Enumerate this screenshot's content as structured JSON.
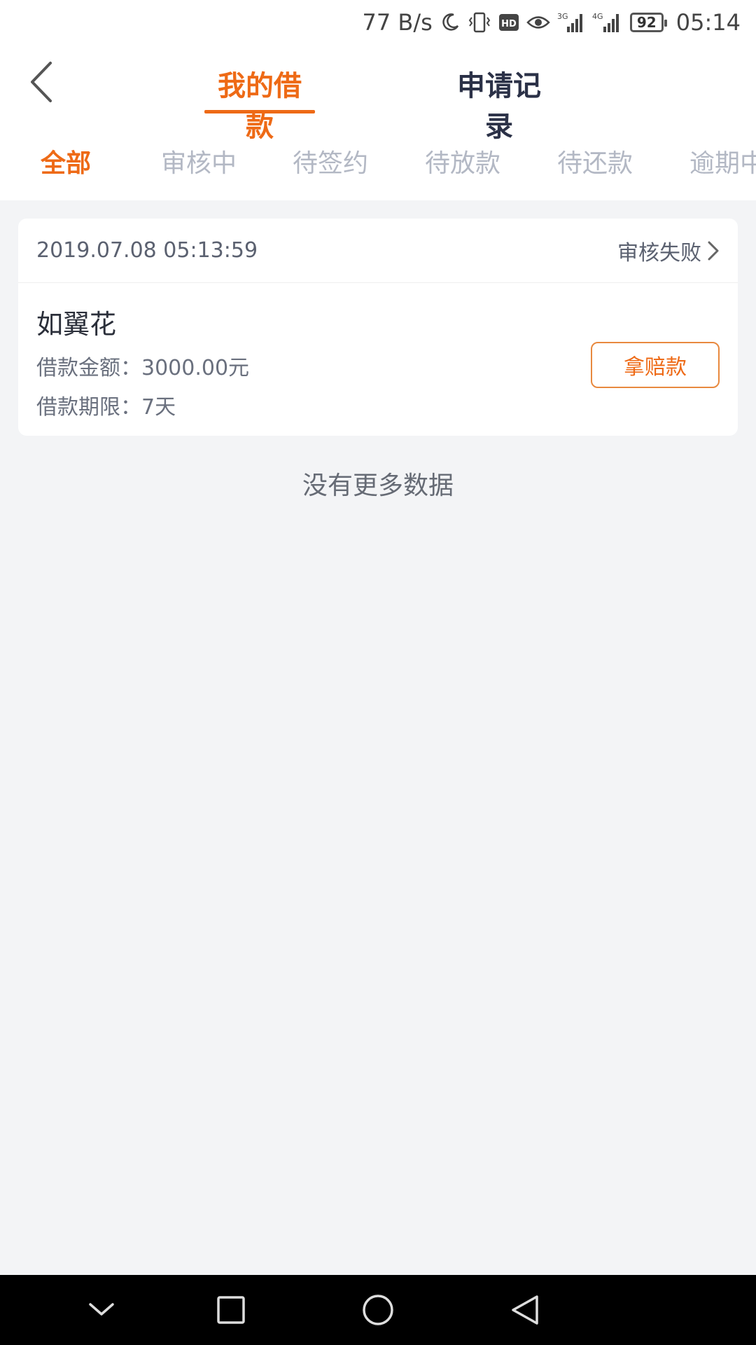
{
  "status_bar": {
    "speed": "77 B/s",
    "hd_label": "HD",
    "net1": "3G",
    "net2": "4G",
    "battery": "92",
    "time": "05:14",
    "icons": [
      "moon-icon",
      "vibrate-icon",
      "hd-icon",
      "eye-icon",
      "signal-3g-icon",
      "signal-4g-icon",
      "battery-icon"
    ]
  },
  "header": {
    "back_icon": "chevron-left-icon",
    "tabs": [
      {
        "label": "我的借款",
        "active": true
      },
      {
        "label": "申请记录",
        "active": false
      }
    ]
  },
  "filter_tabs": [
    {
      "label": "全部",
      "active": true
    },
    {
      "label": "审核中",
      "active": false
    },
    {
      "label": "待签约",
      "active": false
    },
    {
      "label": "待放款",
      "active": false
    },
    {
      "label": "待还款",
      "active": false
    },
    {
      "label": "逾期中",
      "active": false
    }
  ],
  "loan_card": {
    "date": "2019.07.08 05:13:59",
    "status": "审核失败",
    "product": "如翼花",
    "amount_line": "借款金额：3000.00元",
    "term_line": "借款期限：7天",
    "action_label": "拿赔款"
  },
  "list_footer": "没有更多数据",
  "colors": {
    "accent": "#ee6a16",
    "header_inactive": "#2b3147",
    "tab_inactive": "#b3b8c4",
    "background": "#f3f4f6"
  },
  "nav_bar": {
    "icons": [
      "chevron-down-icon",
      "square-icon",
      "circle-icon",
      "triangle-back-icon"
    ]
  }
}
